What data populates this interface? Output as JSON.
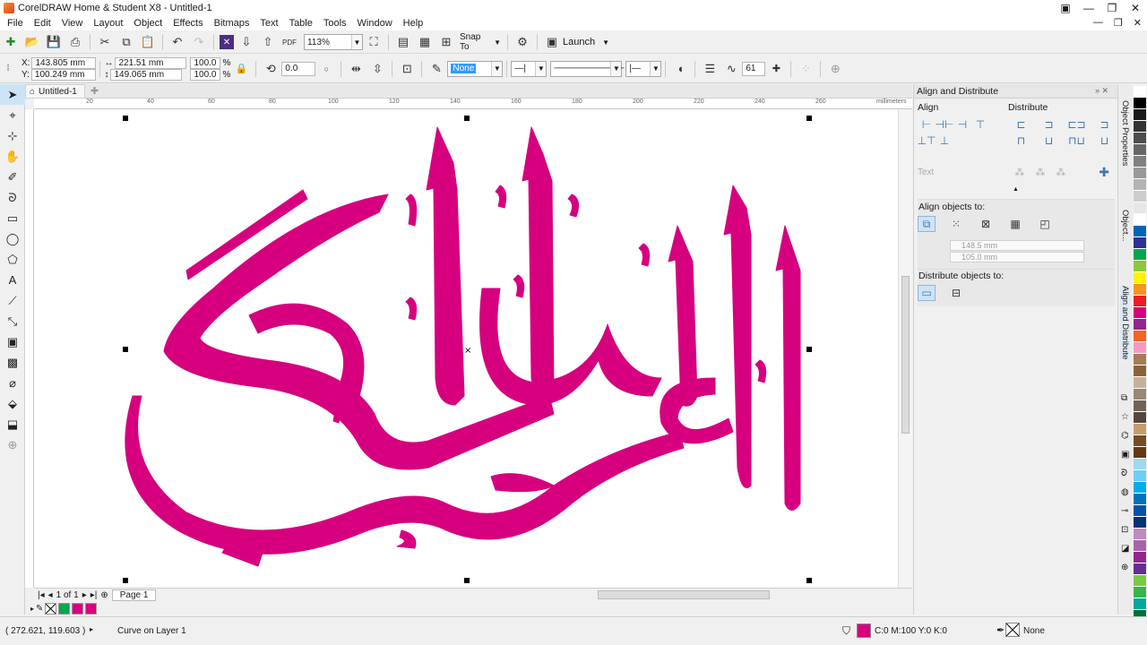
{
  "window": {
    "title": "CorelDRAW Home & Student X8 - Untitled-1"
  },
  "menu": [
    "File",
    "Edit",
    "View",
    "Layout",
    "Object",
    "Effects",
    "Bitmaps",
    "Text",
    "Table",
    "Tools",
    "Window",
    "Help"
  ],
  "standard_toolbar": {
    "zoom": "113%",
    "snap_to": "Snap To",
    "launch": "Launch"
  },
  "property_bar": {
    "x": "143.805 mm",
    "y": "100.249 mm",
    "width": "221.51 mm",
    "height": "149.065 mm",
    "scale_x": "100.0",
    "scale_y": "100.0",
    "percent": "%",
    "rotation": "0.0",
    "outline_fill": "None",
    "counter": "61"
  },
  "document": {
    "tab": "Untitled-1"
  },
  "ruler": {
    "h_ticks": [
      "20",
      "40",
      "60",
      "80",
      "100",
      "120",
      "140",
      "160",
      "180",
      "200",
      "220",
      "240",
      "260"
    ],
    "units": "millimeters"
  },
  "page_nav": {
    "page_of": "1 of 1",
    "page_tab": "Page 1"
  },
  "status": {
    "coords": "( 272.621, 119.603 )",
    "object_info": "Curve on Layer 1",
    "fill_info": "C:0 M:100 Y:0 K:0",
    "outline": "None"
  },
  "docker": {
    "title": "Align and Distribute",
    "align_label": "Align",
    "distribute_label": "Distribute",
    "text_label": "Text",
    "align_objects_to": "Align objects to:",
    "field_x": "148.5 mm",
    "field_y": "105.0 mm",
    "distribute_objects_to": "Distribute objects to:"
  },
  "docker_tabs": [
    "Object Properties",
    "Object...",
    "Align and Distribute"
  ],
  "calligraphy": {
    "color": "#d6007f",
    "text": "القرآن الحكيم"
  },
  "palette_colors": [
    "#ffffff",
    "#000000",
    "#1a1a1a",
    "#333333",
    "#4d4d4d",
    "#666666",
    "#808080",
    "#999999",
    "#b3b3b3",
    "#cccccc",
    "#e6e6e6",
    "#ffffff",
    "#0066b3",
    "#2e3192",
    "#00a651",
    "#8dc63f",
    "#fff200",
    "#f7941d",
    "#ed1c24",
    "#d6007f",
    "#92278f",
    "#f26522",
    "#f49ac1",
    "#a67c52",
    "#8c6239",
    "#c7b299",
    "#998675",
    "#736357",
    "#534741",
    "#c69c6d",
    "#754c24",
    "#603913",
    "#a0d8ef",
    "#6dcff6",
    "#00aeef",
    "#0072bc",
    "#0054a6",
    "#003471",
    "#bd8cbf",
    "#a864a8",
    "#92278f",
    "#662d91",
    "#7ac943",
    "#39b54a",
    "#00a99d",
    "#007236",
    "#005e20",
    "#1b1464"
  ],
  "doc_palette": [
    "#ffffff",
    "#00a651",
    "#d6007f",
    "#d6007f"
  ]
}
